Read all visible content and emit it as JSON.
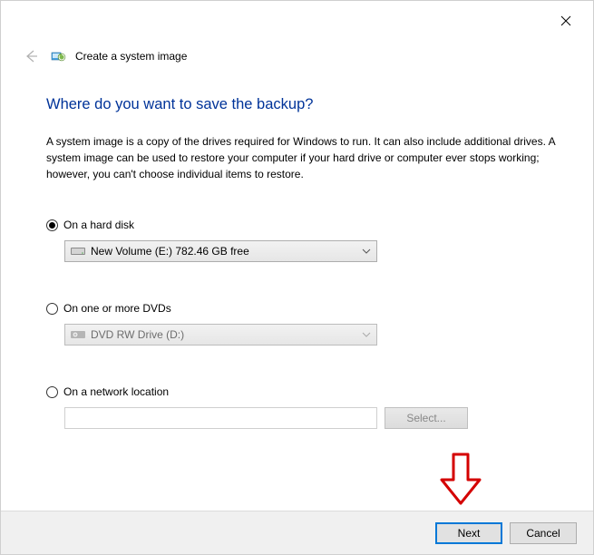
{
  "header": {
    "title": "Create a system image"
  },
  "main": {
    "question": "Where do you want to save the backup?",
    "description": "A system image is a copy of the drives required for Windows to run. It can also include additional drives. A system image can be used to restore your computer if your hard drive or computer ever stops working; however, you can't choose individual items to restore."
  },
  "options": {
    "hard_disk": {
      "label": "On a hard disk",
      "value": "New Volume (E:)  782.46 GB free"
    },
    "dvd": {
      "label": "On one or more DVDs",
      "value": "DVD RW Drive (D:)"
    },
    "network": {
      "label": "On a network location",
      "value": "",
      "select_button": "Select..."
    }
  },
  "footer": {
    "next": "Next",
    "cancel": "Cancel"
  }
}
